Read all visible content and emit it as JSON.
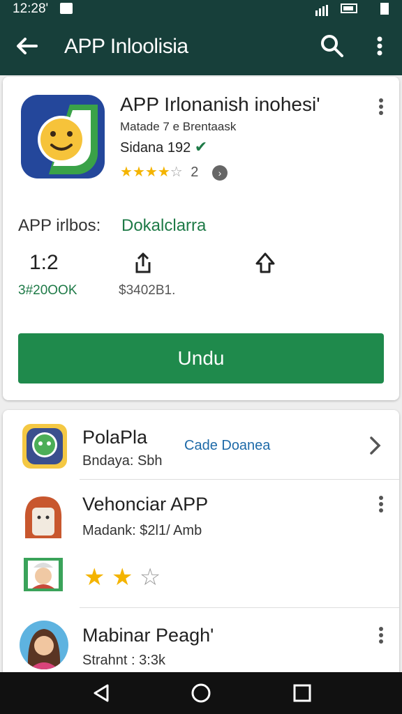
{
  "status": {
    "time": "12:28'"
  },
  "appbar": {
    "title": "APP Inloolisia"
  },
  "app": {
    "name": "APP Irlonanish inohesi'",
    "developer": "Matade 7 e Brentaask",
    "size": "Sidana 192",
    "rating_stars": 4,
    "rating_text": "2"
  },
  "info": {
    "label": "APP irlbos:",
    "value": "Dokalclarra"
  },
  "stats": {
    "value": "1:2",
    "sub1": "3#20OOK",
    "sub2": "$3402B1."
  },
  "install": {
    "label": "Undu"
  },
  "list": [
    {
      "title": "PolaPla",
      "subtitle": "Bndaya: Sbh",
      "action": "Cade Doanea"
    },
    {
      "title": "Vehonciar APP",
      "subtitle": "Madank: $2l1/ Amb"
    },
    {
      "title": "",
      "stars": 2
    },
    {
      "title": "Mabinar Peagh'",
      "subtitle": "Strahnt : 3:3k"
    }
  ],
  "colors": {
    "appbar": "#173f3a",
    "accent": "#1f8a4c",
    "star": "#f4b400",
    "link": "#1e6aa8"
  }
}
